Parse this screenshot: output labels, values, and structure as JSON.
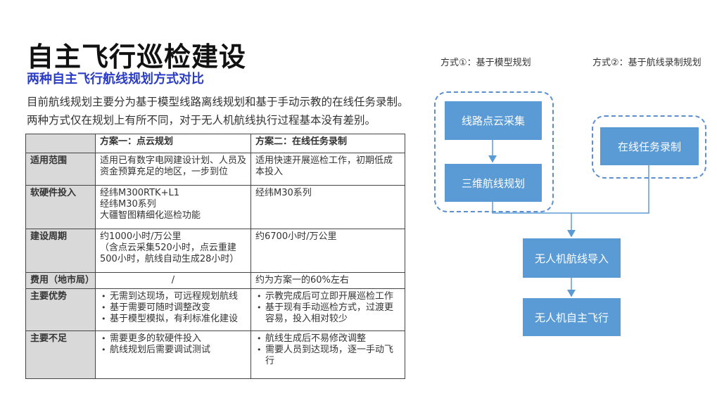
{
  "title": "自主飞行巡检建设",
  "subtitle": "两种自主飞行航线规划方式对比",
  "intro": [
    "目前航线规划主要分为基于模型线路离线规划和基于手动示教的在线任务录制。",
    "两种方式仅在规划上有所不同，对于无人机航线执行过程基本没有差别。"
  ],
  "table": {
    "headers": [
      "",
      "方案一：点云规划",
      "方案二：在线任务录制"
    ],
    "rows": [
      {
        "label": "适用范围",
        "a": "适用已有数字电网建设计划、人员及资金预算充足的地区，一步到位",
        "b": "适用快速开展巡检工作，初期低成本投入"
      },
      {
        "label": "软硬件投入",
        "a": "经纬M300RTK+L1\n经纬M30系列\n大疆智图精细化巡检功能",
        "b": "经纬M30系列"
      },
      {
        "label": "建设周期",
        "a": "约1000小时/万公里\n（含点云采集520小时，点云重建500小时，航线自动生成28小时）",
        "b": "约6700小时/万公里"
      },
      {
        "label": "费用（地市局）",
        "a": "/",
        "b": "约为方案一的60%左右"
      },
      {
        "label": "主要优势",
        "a_list": [
          "无需到达现场，可远程规划航线",
          "基于需要可随时调整改变",
          "基于模型模拟，有利标准化建设"
        ],
        "b_list": [
          "示教完成后可立即开展巡检工作",
          "基于现有手动巡检方式，过渡更容易，投入相对较少"
        ]
      },
      {
        "label": "主要不足",
        "a_list": [
          "需要更多的软硬件投入",
          "航线规划后需要调试测试"
        ],
        "b_list": [
          "航线生成后不易修改调整",
          "需要人员到达现场，逐一手动飞行"
        ]
      }
    ]
  },
  "diagram": {
    "method1_label": "方式①：基于模型规划",
    "method2_label": "方式②：基于航线录制规划",
    "box_pointcloud": "线路点云采集",
    "box_3d": "三维航线规划",
    "box_online": "在线任务录制",
    "box_import": "无人机航线导入",
    "box_fly": "无人机自主飞行"
  },
  "colors": {
    "accent": "#2b3cc4",
    "box": "#5b9bd5",
    "dash": "#5b8fd0"
  }
}
